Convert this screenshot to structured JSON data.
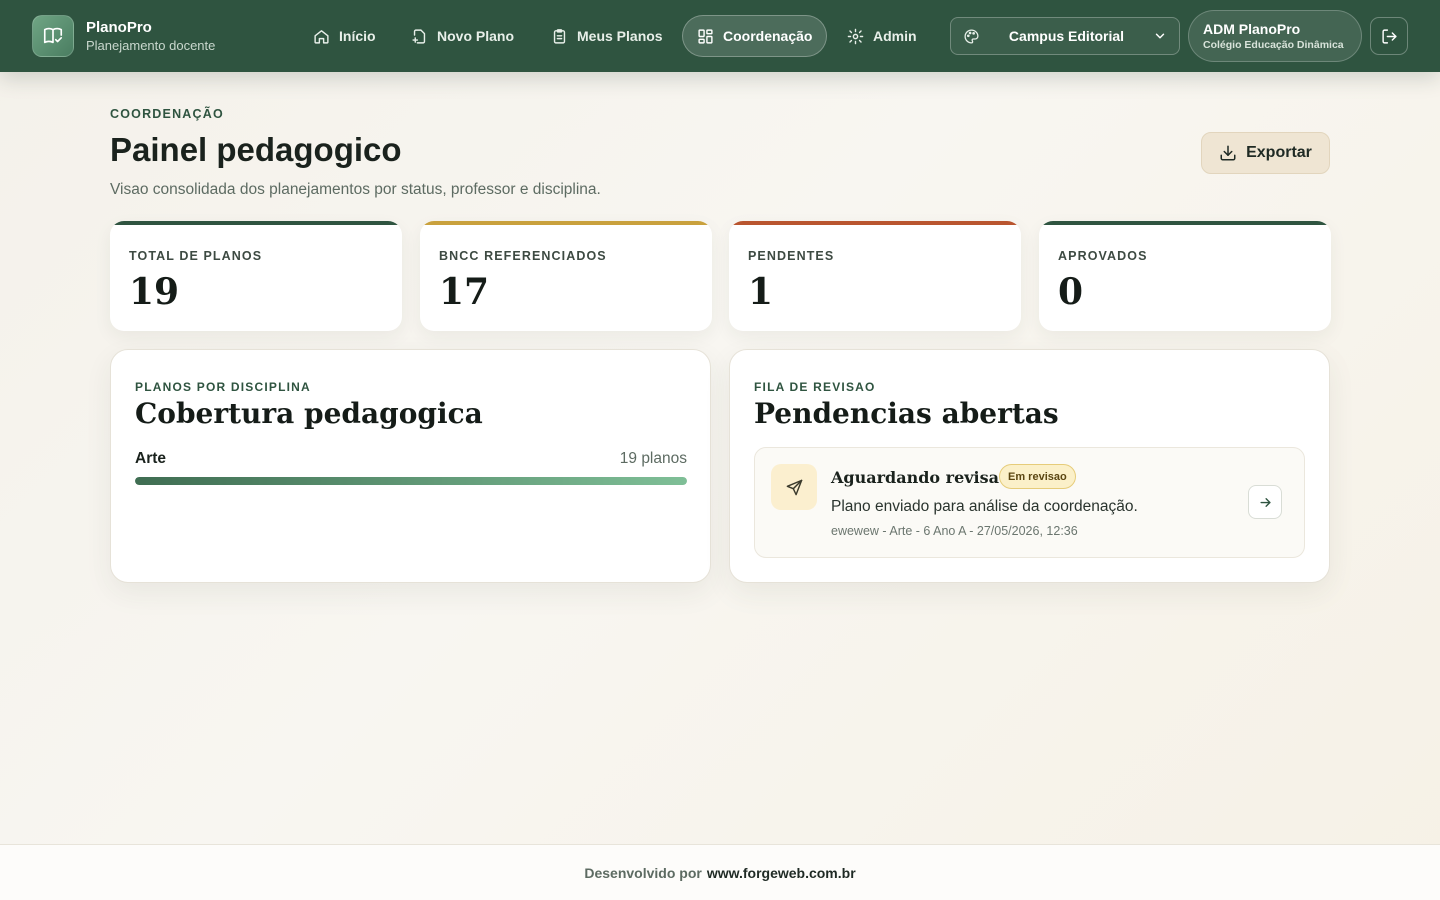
{
  "brand": {
    "name": "PlanoPro",
    "subtitle": "Planejamento docente"
  },
  "nav": {
    "items": [
      {
        "label": "Início",
        "icon": "home-icon"
      },
      {
        "label": "Novo Plano",
        "icon": "file-plus-icon"
      },
      {
        "label": "Meus Planos",
        "icon": "clipboard-icon"
      },
      {
        "label": "Coordenação",
        "icon": "dashboard-icon",
        "active": true
      },
      {
        "label": "Admin",
        "icon": "gear-icon"
      }
    ],
    "campus": "Campus Editorial",
    "user": {
      "name": "ADM PlanoPro",
      "org": "Colégio Educação Dinâmica"
    }
  },
  "header": {
    "eyebrow": "COORDENAÇÃO",
    "title": "Painel pedagogico",
    "subtitle": "Visao consolidada dos planejamentos por status, professor e disciplina.",
    "export_label": "Exportar"
  },
  "stats": [
    {
      "label": "TOTAL DE PLANOS",
      "value": "19",
      "accent": "#2f5440"
    },
    {
      "label": "BNCC REFERENCIADOS",
      "value": "17",
      "accent": "#c9a13d"
    },
    {
      "label": "PENDENTES",
      "value": "1",
      "accent": "#b9552f"
    },
    {
      "label": "APROVADOS",
      "value": "0",
      "accent": "#2f5440"
    }
  ],
  "coverage": {
    "eyebrow": "PLANOS POR DISCIPLINA",
    "title": "Cobertura pedagogica",
    "rows": [
      {
        "name": "Arte",
        "count": "19 planos",
        "fraction": 1.0
      }
    ]
  },
  "review": {
    "eyebrow": "FILA DE REVISAO",
    "title": "Pendencias abertas",
    "items": [
      {
        "title": "Aguardando revisao",
        "badge": "Em revisao",
        "description": "Plano enviado para análise da coordenação.",
        "meta": "ewewew - Arte - 6 Ano A - 27/05/2026, 12:36"
      }
    ]
  },
  "footer": {
    "prefix": "Desenvolvido por",
    "link": "www.forgeweb.com.br"
  }
}
